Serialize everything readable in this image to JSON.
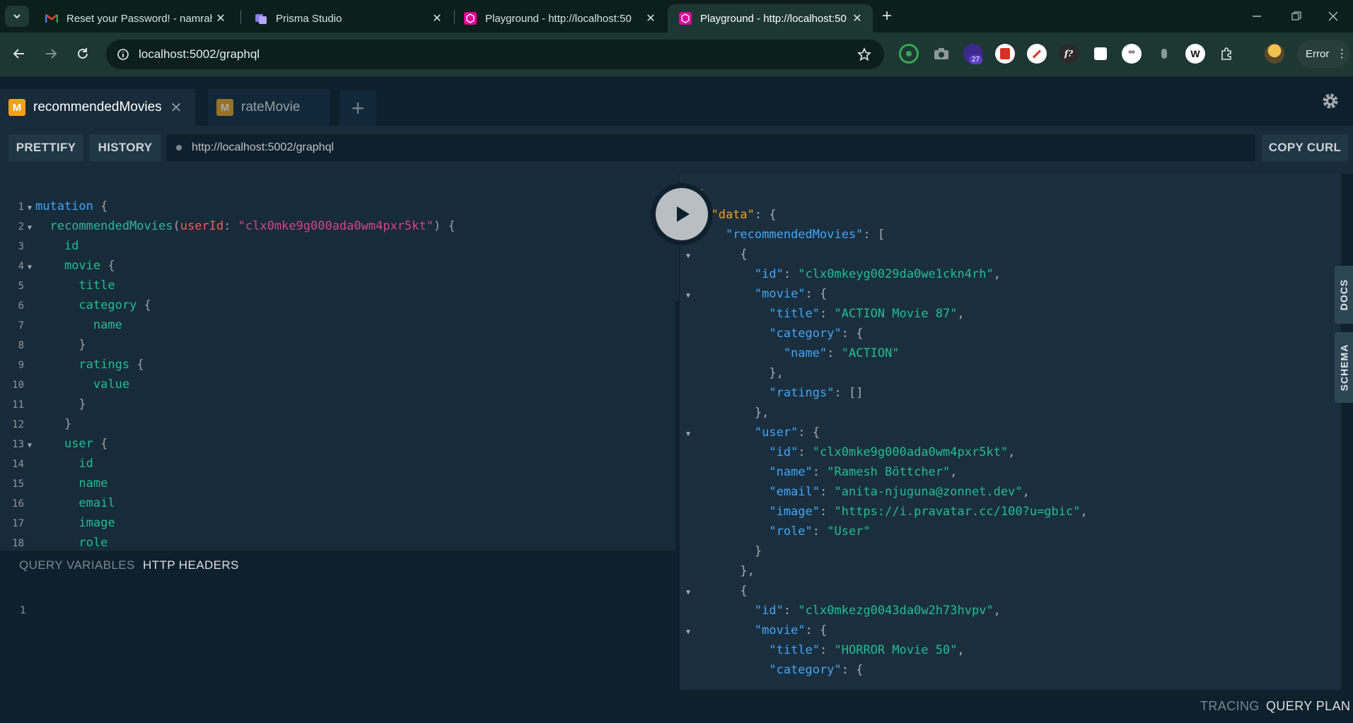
{
  "browser": {
    "tabs": [
      {
        "title": "Reset your Password! - namrahs",
        "icon": "gmail-icon"
      },
      {
        "title": "Prisma Studio",
        "icon": "prisma-icon"
      },
      {
        "title": "Playground - http://localhost:50",
        "icon": "graphql-icon"
      },
      {
        "title": "Playground - http://localhost:50",
        "icon": "graphql-icon"
      }
    ],
    "url": "localhost:5002/graphql",
    "extension_badge": "27",
    "profile_label": "Error"
  },
  "playground": {
    "tabs": [
      {
        "badge": "M",
        "label": "recommendedMovies"
      },
      {
        "badge": "M",
        "label": "rateMovie"
      }
    ],
    "prettify_label": "PRETTIFY",
    "history_label": "HISTORY",
    "endpoint": "http://localhost:5002/graphql",
    "copy_curl_label": "COPY CURL",
    "query_variables_label": "QUERY VARIABLES",
    "http_headers_label": "HTTP HEADERS",
    "variables_line": "1",
    "docs_label": "DOCS",
    "schema_label": "SCHEMA",
    "tracing_label": "TRACING",
    "query_plan_label": "QUERY PLAN",
    "line_numbers": [
      "1",
      "2",
      "3",
      "4",
      "5",
      "6",
      "7",
      "8",
      "9",
      "10",
      "11",
      "12",
      "13",
      "14",
      "15",
      "16",
      "17",
      "18"
    ],
    "query_tokens": {
      "mutation": "mutation",
      "root_field": "recommendedMovies",
      "arg_name": "userId",
      "arg_value": "\"clx0mke9g000ada0wm4pxr5kt\"",
      "id": "id",
      "movie": "movie",
      "title": "title",
      "category": "category",
      "name": "name",
      "ratings": "ratings",
      "value": "value",
      "user": "user",
      "email": "email",
      "image": "image",
      "role": "role"
    },
    "result": {
      "data_key": "\"data\"",
      "rec_key": "\"recommendedMovies\"",
      "id_key": "\"id\"",
      "movie_key": "\"movie\"",
      "title_key": "\"title\"",
      "category_key": "\"category\"",
      "name_key": "\"name\"",
      "ratings_key": "\"ratings\"",
      "user_key": "\"user\"",
      "email_key": "\"email\"",
      "image_key": "\"image\"",
      "role_key": "\"role\"",
      "item1_id": "\"clx0mkeyg0029da0we1ckn4rh\"",
      "item1_title": "\"ACTION Movie 87\"",
      "item1_category": "\"ACTION\"",
      "item1_ratings": "[]",
      "user_id": "\"clx0mke9g000ada0wm4pxr5kt\"",
      "user_name": "\"Ramesh Böttcher\"",
      "user_email": "\"anita-njuguna@zonnet.dev\"",
      "user_image": "\"https://i.pravatar.cc/100?u=gbic\"",
      "user_role": "\"User\"",
      "item2_id": "\"clx0mkezg0043da0w2h73hvpv\"",
      "item2_title": "\"HORROR Movie 50\""
    }
  }
}
